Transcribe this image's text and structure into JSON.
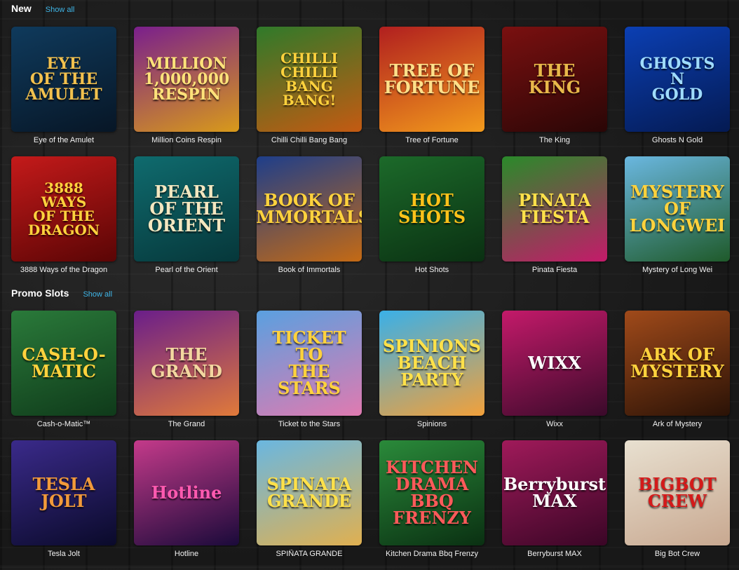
{
  "sections": [
    {
      "title": "New",
      "show_all": "Show all",
      "games": [
        {
          "name": "Eye of the Amulet",
          "logo": "EYE\nOF THE\nAMULET",
          "bg1": "#0f3a5c",
          "bg2": "#071626",
          "fg": "#f2c14e"
        },
        {
          "name": "Million Coins Respin",
          "logo": "MILLION\n1,000,000\nRESPIN",
          "bg1": "#7a1f8c",
          "bg2": "#d89a1a",
          "fg": "#ffe27a"
        },
        {
          "name": "Chilli Chilli Bang Bang",
          "logo": "CHILLI\nCHILLI\nBANG\nBANG!",
          "bg1": "#2f7a2a",
          "bg2": "#c45a12",
          "fg": "#ffd23d"
        },
        {
          "name": "Tree of Fortune",
          "logo": "TREE OF FORTUNE",
          "bg1": "#b11f1f",
          "bg2": "#f29a1c",
          "fg": "#ffe08a"
        },
        {
          "name": "The King",
          "logo": "THE\nKING",
          "bg1": "#7a1010",
          "bg2": "#2a0606",
          "fg": "#e8b84a"
        },
        {
          "name": "Ghosts N Gold",
          "logo": "GHOSTS\nN\nGOLD",
          "bg1": "#0b3fb3",
          "bg2": "#041a52",
          "fg": "#9fdcff"
        },
        {
          "name": "3888 Ways of the Dragon",
          "logo": "3888\nWAYS\nOF THE\nDRAGON",
          "bg1": "#c41a1a",
          "bg2": "#5a0505",
          "fg": "#ffd23d"
        },
        {
          "name": "Pearl of the Orient",
          "logo": "PEARL OF THE\nORIENT",
          "bg1": "#0f6b6e",
          "bg2": "#06373a",
          "fg": "#f3e7c0"
        },
        {
          "name": "Book of Immortals",
          "logo": "BOOK OF\nIMMORTALS",
          "bg1": "#1e3e8a",
          "bg2": "#c46a14",
          "fg": "#ffd23d"
        },
        {
          "name": "Hot Shots",
          "logo": "HOT\nSHOTS",
          "bg1": "#1c6a2a",
          "bg2": "#0a3012",
          "fg": "#ffc21a"
        },
        {
          "name": "Pinata Fiesta",
          "logo": "PINATA\nFIESTA",
          "bg1": "#2a8a2a",
          "bg2": "#c41a6a",
          "fg": "#ffe14a"
        },
        {
          "name": "Mystery of Long Wei",
          "logo": "MYSTERY OF\nLONGWEI",
          "bg1": "#6ab7e0",
          "bg2": "#1f5a2a",
          "fg": "#ffd23d"
        }
      ]
    },
    {
      "title": "Promo Slots",
      "show_all": "Show all",
      "games": [
        {
          "name": "Cash-o-Matic™",
          "logo": "CASH-O-MATIC",
          "bg1": "#2a7a3a",
          "bg2": "#0f3a1a",
          "fg": "#ffd23d"
        },
        {
          "name": "The Grand",
          "logo": "THE\nGRAND",
          "bg1": "#6a1e8a",
          "bg2": "#e07a3a",
          "fg": "#f3d7a0"
        },
        {
          "name": "Ticket to the Stars",
          "logo": "TICKET TO\nTHE STARS",
          "bg1": "#5aa0e0",
          "bg2": "#e07ab0",
          "fg": "#ffd23d"
        },
        {
          "name": "Spinions",
          "logo": "SPINIONS\nBEACH PARTY",
          "bg1": "#3ab0e8",
          "bg2": "#f2a03a",
          "fg": "#ffe14a"
        },
        {
          "name": "Wixx",
          "logo": "WIXX",
          "bg1": "#c41a6a",
          "bg2": "#3a0a2a",
          "fg": "#ffffff"
        },
        {
          "name": "Ark of Mystery",
          "logo": "ARK OF\nMYSTERY",
          "bg1": "#a04a1a",
          "bg2": "#2a1206",
          "fg": "#ffd23d"
        },
        {
          "name": "Tesla Jolt",
          "logo": "TESLA\nJOLT",
          "bg1": "#3a2a8a",
          "bg2": "#0a0a2a",
          "fg": "#f29a3a"
        },
        {
          "name": "Hotline",
          "logo": "Hotline",
          "bg1": "#c43a8a",
          "bg2": "#1a0a3a",
          "fg": "#ff5ab0"
        },
        {
          "name": "SPIÑATA GRANDE",
          "logo": "SPINATA\nGRANDE",
          "bg1": "#6ab7e0",
          "bg2": "#e0b050",
          "fg": "#ffe14a"
        },
        {
          "name": "Kitchen Drama Bbq Frenzy",
          "logo": "KITCHEN DRAMA\nBBQ FRENZY",
          "bg1": "#2a8a3a",
          "bg2": "#0a3012",
          "fg": "#ff5a5a"
        },
        {
          "name": "Berryburst MAX",
          "logo": "Berryburst\nMAX",
          "bg1": "#a01a5a",
          "bg2": "#3a0626",
          "fg": "#ffffff"
        },
        {
          "name": "Big Bot Crew",
          "logo": "BIGBOT\nCREW",
          "bg1": "#e8e0d0",
          "bg2": "#c8a890",
          "fg": "#d41a1a"
        }
      ]
    }
  ]
}
